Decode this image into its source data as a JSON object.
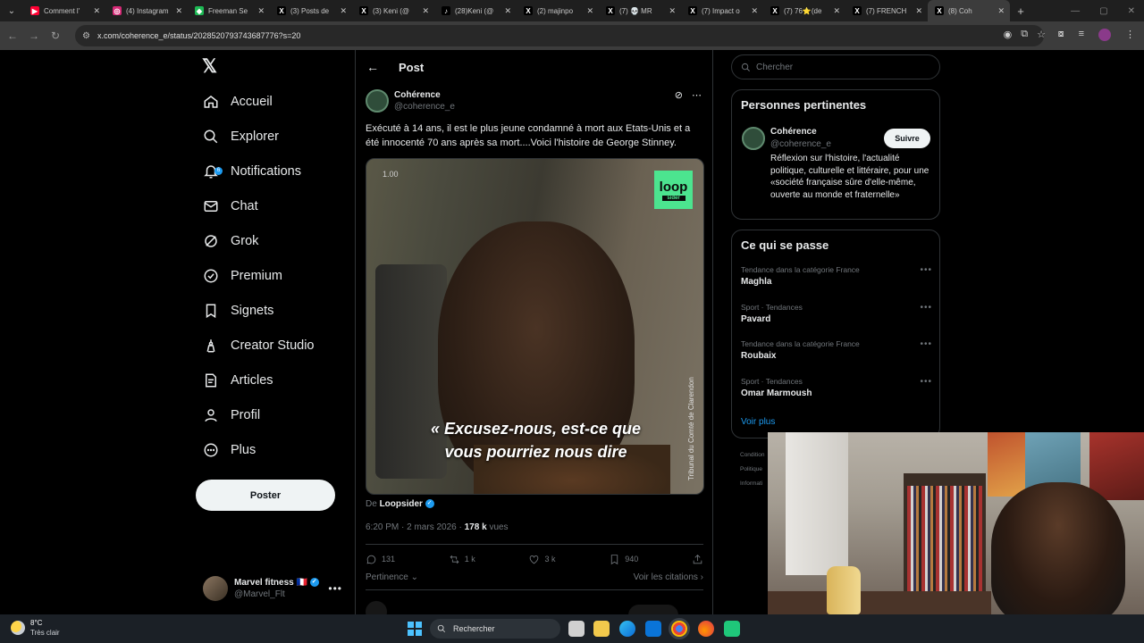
{
  "browser": {
    "tabs": [
      {
        "label": "Comment l'",
        "fav_color": "#ff0033",
        "fav_glyph": "▶"
      },
      {
        "label": "(4) Instagram",
        "fav_color": "#d62976",
        "fav_glyph": "◎"
      },
      {
        "label": "Freeman Se",
        "fav_color": "#1db954",
        "fav_glyph": "◆"
      },
      {
        "label": "(3) Posts de",
        "fav_color": "#000000",
        "fav_glyph": "X"
      },
      {
        "label": "(3) Keni (@",
        "fav_color": "#000000",
        "fav_glyph": "X"
      },
      {
        "label": "(28)Keni (@",
        "fav_color": "#000000",
        "fav_glyph": "♪"
      },
      {
        "label": "(2) majinpo",
        "fav_color": "#000000",
        "fav_glyph": "X"
      },
      {
        "label": "(7) 💀 MR",
        "fav_color": "#000000",
        "fav_glyph": "X"
      },
      {
        "label": "(7) Impact o",
        "fav_color": "#000000",
        "fav_glyph": "X"
      },
      {
        "label": "(7) 76⭐(de",
        "fav_color": "#000000",
        "fav_glyph": "X"
      },
      {
        "label": "(7) FRENCH",
        "fav_color": "#000000",
        "fav_glyph": "X"
      },
      {
        "label": "(8) Coh",
        "fav_color": "#000000",
        "fav_glyph": "X",
        "active": true
      }
    ],
    "url": "x.com/coherence_e/status/2028520793743687776?s=20"
  },
  "nav": {
    "items": [
      {
        "label": "Accueil",
        "icon": "home-icon"
      },
      {
        "label": "Explorer",
        "icon": "search-icon"
      },
      {
        "label": "Notifications",
        "icon": "bell-icon"
      },
      {
        "label": "Chat",
        "icon": "mail-icon"
      },
      {
        "label": "Grok",
        "icon": "grok-icon"
      },
      {
        "label": "Premium",
        "icon": "premium-icon"
      },
      {
        "label": "Signets",
        "icon": "bookmark-icon"
      },
      {
        "label": "Creator Studio",
        "icon": "creator-icon"
      },
      {
        "label": "Articles",
        "icon": "article-icon"
      },
      {
        "label": "Profil",
        "icon": "profile-icon"
      },
      {
        "label": "Plus",
        "icon": "more-icon"
      }
    ],
    "notif_badge": "6",
    "post_button": "Poster",
    "account": {
      "name": "Marvel fitness 🇫🇷",
      "handle": "@Marvel_Flt"
    }
  },
  "post": {
    "header_title": "Post",
    "author": {
      "name": "Cohérence",
      "handle": "@coherence_e"
    },
    "text": "Exécuté à 14 ans, il est le plus jeune condamné à mort aux Etats-Unis et a été innocenté 70 ans après sa mort....Voici l'histoire de George Stinney.",
    "video": {
      "time": "1.00",
      "logo_line1": "loop",
      "logo_line2": "sider",
      "credit": "Tribunal du Comté de Clarendon",
      "subtitle_line1": "« Excusez-nous, est-ce que",
      "subtitle_line2": "vous pourriez nous dire"
    },
    "from_prefix": "De",
    "from_name": "Loopsider",
    "time": "6:20 PM",
    "date": "2 mars 2026",
    "views_count": "178 k",
    "views_label": "vues",
    "replies": "131",
    "reposts": "1 k",
    "likes": "3 k",
    "bookmarks": "940",
    "sort_label": "Pertinence",
    "quotes_link": "Voir les citations"
  },
  "sidebar": {
    "search_placeholder": "Chercher",
    "relevant_title": "Personnes pertinentes",
    "relevant": {
      "name": "Cohérence",
      "handle": "@coherence_e",
      "follow": "Suivre",
      "bio": "Réflexion sur l'histoire, l'actualité politique, culturelle et littéraire, pour une «société française sûre d'elle-même, ouverte au monde et fraternelle»"
    },
    "trends_title": "Ce qui se passe",
    "trends": [
      {
        "category": "Tendance dans la catégorie France",
        "name": "Maghla"
      },
      {
        "category": "Sport · Tendances",
        "name": "Pavard"
      },
      {
        "category": "Tendance dans la catégorie France",
        "name": "Roubaix"
      },
      {
        "category": "Sport · Tendances",
        "name": "Omar Marmoush"
      }
    ],
    "see_more": "Voir plus",
    "footer": [
      "Condition",
      "Politique",
      "Informati"
    ]
  },
  "taskbar": {
    "temp": "8°C",
    "weather": "Très clair",
    "search": "Rechercher"
  }
}
